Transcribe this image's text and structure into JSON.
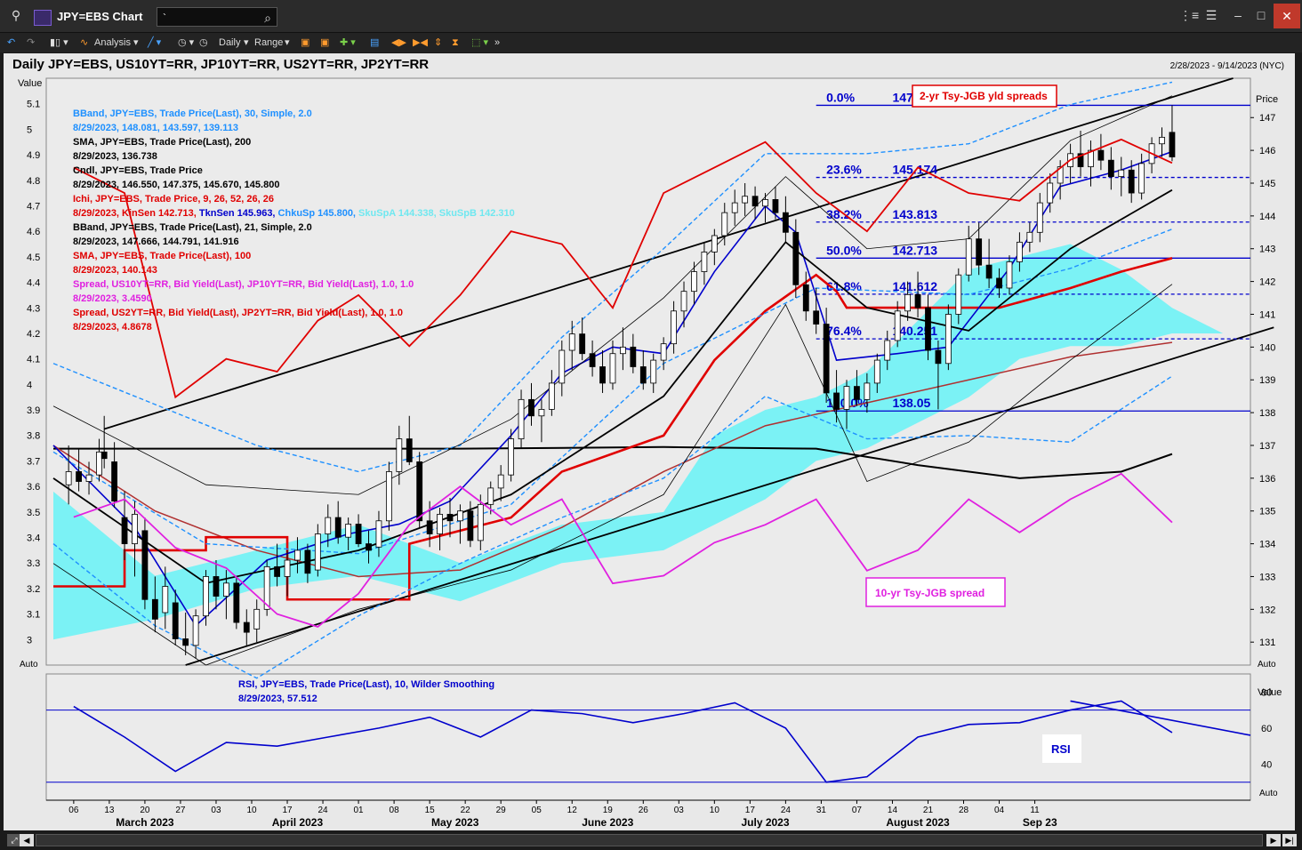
{
  "window": {
    "title": "JPY=EBS Chart (*)",
    "search_value": "`"
  },
  "toolbar": {
    "analysis_label": "Analysis",
    "interval_label": "Daily",
    "range_label": "Range"
  },
  "chart_header": {
    "title": "Daily JPY=EBS, US10YT=RR, JP10YT=RR, US2YT=RR, JP2YT=RR",
    "date_range": "2/28/2023 - 9/14/2023 (NYC)"
  },
  "axes": {
    "left_label": "Value",
    "right_label": "Price",
    "rsi_right_label": "Value",
    "auto_label": "Auto",
    "left_ticks": [
      "5.1",
      "5",
      "4.9",
      "4.8",
      "4.7",
      "4.6",
      "4.5",
      "4.4",
      "4.3",
      "4.2",
      "4.1",
      "4",
      "3.9",
      "3.8",
      "3.7",
      "3.6",
      "3.5",
      "3.4",
      "3.3",
      "3.2",
      "3.1",
      "3"
    ],
    "right_ticks": [
      "147",
      "146",
      "145",
      "144",
      "143",
      "142",
      "141",
      "140",
      "139",
      "138",
      "137",
      "136",
      "135",
      "134",
      "133",
      "132",
      "131"
    ],
    "rsi_ticks": [
      "80",
      "60",
      "40"
    ],
    "x_days": [
      "06",
      "13",
      "20",
      "27",
      "03",
      "10",
      "17",
      "24",
      "01",
      "08",
      "15",
      "22",
      "29",
      "05",
      "12",
      "19",
      "26",
      "03",
      "10",
      "17",
      "24",
      "31",
      "07",
      "14",
      "21",
      "28",
      "04",
      "11"
    ],
    "x_months": [
      "March 2023",
      "April 2023",
      "May 2023",
      "June 2023",
      "July 2023",
      "August 2023",
      "Sep 23"
    ]
  },
  "legend": [
    {
      "text": "BBand, JPY=EBS, Trade Price(Last),  30, Simple, 2.0",
      "color": "#1e90ff"
    },
    {
      "text": "8/29/2023, 148.081, 143.597, 139.113",
      "color": "#1e90ff"
    },
    {
      "text": "SMA, JPY=EBS, Trade Price(Last),  200",
      "color": "#000000"
    },
    {
      "text": "8/29/2023, 136.738",
      "color": "#000000"
    },
    {
      "text": "Cndl, JPY=EBS, Trade Price",
      "color": "#000000"
    },
    {
      "text": "8/29/2023, 146.550, 147.375, 145.670, 145.800",
      "color": "#000000"
    },
    {
      "text": "Ichi, JPY=EBS, Trade Price,  9, 26, 52, 26, 26",
      "color": "#e00000"
    },
    {
      "text": "8/29/2023, KinSen 142.713,",
      "color": "#e00000",
      "extra": [
        {
          "text": " TknSen 145.963,",
          "color": "#0000cc"
        },
        {
          "text": " ChkuSp 145.800,",
          "color": "#1e90ff"
        },
        {
          "text": " SkuSpA 144.338,",
          "color": "#6fe8f0"
        },
        {
          "text": " SkuSpB 142.310",
          "color": "#6fe8f0"
        }
      ]
    },
    {
      "text": "BBand, JPY=EBS, Trade Price(Last),  21, Simple, 2.0",
      "color": "#000000"
    },
    {
      "text": "8/29/2023, 147.666, 144.791, 141.916",
      "color": "#000000"
    },
    {
      "text": "SMA, JPY=EBS, Trade Price(Last),  100",
      "color": "#e00000"
    },
    {
      "text": "8/29/2023, 140.143",
      "color": "#e00000"
    },
    {
      "text": "Spread, US10YT=RR, Bid Yield(Last), JP10YT=RR, Bid Yield(Last),  1.0, 1.0",
      "color": "#e020e0"
    },
    {
      "text": "8/29/2023, 3.4590",
      "color": "#e020e0"
    },
    {
      "text": "Spread, US2YT=RR, Bid Yield(Last), JP2YT=RR, Bid Yield(Last),  1.0, 1.0",
      "color": "#e00000"
    },
    {
      "text": "8/29/2023, 4.8678",
      "color": "#e00000"
    }
  ],
  "fib_levels": [
    {
      "pct": "0.0%",
      "value": "147.375",
      "price": 147.375
    },
    {
      "pct": "23.6%",
      "value": "145.174",
      "price": 145.174
    },
    {
      "pct": "38.2%",
      "value": "143.813",
      "price": 143.813
    },
    {
      "pct": "50.0%",
      "value": "142.713",
      "price": 142.713
    },
    {
      "pct": "61.8%",
      "value": "141.612",
      "price": 141.612
    },
    {
      "pct": "76.4%",
      "value": "140.251",
      "price": 140.251
    },
    {
      "pct": "100.0%",
      "value": "138.05",
      "price": 138.05
    }
  ],
  "annotations": {
    "two_yr": "2-yr Tsy-JGB yld spreads",
    "ten_yr": "10-yr Tsy-JGB spread",
    "rsi_box": "RSI"
  },
  "rsi_legend": {
    "line1": "RSI, JPY=EBS, Trade Price(Last),  10, Wilder Smoothing",
    "line2": "8/29/2023, 57.512"
  },
  "chart_data": {
    "type": "line",
    "price_axis": {
      "ylim": [
        130.3,
        148.2
      ],
      "label": "Price"
    },
    "value_axis": {
      "ylim": [
        2.9,
        5.2
      ],
      "label": "Value"
    },
    "rsi_axis": {
      "ylim": [
        20,
        90
      ],
      "label": "Value"
    },
    "x_range_days": 198,
    "candles": [
      [
        3,
        135.8,
        137.0,
        135.2,
        136.2
      ],
      [
        5,
        136.2,
        136.9,
        135.6,
        135.9
      ],
      [
        7,
        135.9,
        136.5,
        135.5,
        136.1
      ],
      [
        9,
        136.1,
        137.2,
        135.9,
        136.8
      ],
      [
        10,
        136.8,
        137.9,
        136.3,
        136.6
      ],
      [
        12,
        136.5,
        137.1,
        135.1,
        135.3
      ],
      [
        14,
        134.8,
        135.6,
        133.5,
        134.0
      ],
      [
        16,
        134.0,
        135.3,
        133.0,
        134.9
      ],
      [
        18,
        134.4,
        134.8,
        132.0,
        132.3
      ],
      [
        20,
        132.3,
        133.0,
        131.3,
        131.7
      ],
      [
        22,
        131.9,
        133.3,
        131.4,
        132.7
      ],
      [
        24,
        132.2,
        132.6,
        130.9,
        131.1
      ],
      [
        26,
        131.1,
        131.9,
        130.6,
        130.9
      ],
      [
        28,
        130.9,
        132.0,
        130.5,
        131.8
      ],
      [
        30,
        131.8,
        133.2,
        131.5,
        133.0
      ],
      [
        32,
        133.0,
        133.5,
        132.0,
        132.4
      ],
      [
        34,
        132.4,
        133.2,
        131.7,
        132.8
      ],
      [
        36,
        132.8,
        133.0,
        131.4,
        131.6
      ],
      [
        38,
        131.6,
        132.0,
        130.9,
        131.3
      ],
      [
        40,
        131.4,
        132.3,
        131.0,
        132.0
      ],
      [
        42,
        132.0,
        133.5,
        131.8,
        133.3
      ],
      [
        44,
        133.3,
        134.0,
        132.7,
        133.0
      ],
      [
        46,
        133.0,
        133.8,
        132.4,
        133.5
      ],
      [
        48,
        133.5,
        134.2,
        133.1,
        133.8
      ],
      [
        50,
        133.8,
        134.0,
        132.8,
        133.1
      ],
      [
        52,
        133.2,
        134.6,
        133.0,
        134.3
      ],
      [
        54,
        134.3,
        135.2,
        133.9,
        134.8
      ],
      [
        56,
        134.8,
        135.3,
        134.0,
        134.2
      ],
      [
        58,
        134.2,
        134.8,
        133.8,
        134.6
      ],
      [
        60,
        134.6,
        134.9,
        133.9,
        134.0
      ],
      [
        62,
        134.0,
        134.4,
        133.4,
        133.8
      ],
      [
        64,
        133.9,
        135.0,
        133.6,
        134.7
      ],
      [
        66,
        134.7,
        136.5,
        134.4,
        136.2
      ],
      [
        68,
        136.2,
        137.6,
        135.8,
        137.2
      ],
      [
        70,
        137.2,
        137.9,
        136.4,
        136.5
      ],
      [
        72,
        136.5,
        136.8,
        134.5,
        134.7
      ],
      [
        74,
        134.7,
        135.3,
        133.9,
        134.3
      ],
      [
        76,
        134.3,
        135.1,
        133.8,
        134.9
      ],
      [
        78,
        134.9,
        135.4,
        134.2,
        134.7
      ],
      [
        80,
        134.7,
        135.2,
        134.0,
        135.0
      ],
      [
        82,
        135.0,
        135.3,
        133.9,
        134.1
      ],
      [
        84,
        134.1,
        135.5,
        133.8,
        135.2
      ],
      [
        86,
        135.2,
        135.9,
        134.9,
        135.7
      ],
      [
        88,
        135.7,
        136.4,
        135.3,
        136.1
      ],
      [
        90,
        136.1,
        137.5,
        135.9,
        137.2
      ],
      [
        92,
        137.2,
        138.7,
        136.9,
        138.4
      ],
      [
        94,
        138.4,
        138.9,
        137.6,
        137.9
      ],
      [
        96,
        137.9,
        138.4,
        137.1,
        138.1
      ],
      [
        98,
        138.1,
        139.3,
        137.9,
        138.9
      ],
      [
        100,
        138.9,
        140.2,
        138.5,
        139.9
      ],
      [
        102,
        139.9,
        140.8,
        139.3,
        140.4
      ],
      [
        104,
        140.4,
        140.9,
        139.6,
        139.8
      ],
      [
        106,
        139.8,
        140.2,
        139.1,
        139.4
      ],
      [
        108,
        139.4,
        139.9,
        138.6,
        138.9
      ],
      [
        110,
        138.9,
        140.2,
        138.7,
        139.8
      ],
      [
        112,
        139.8,
        140.6,
        139.3,
        140.0
      ],
      [
        114,
        140.0,
        140.4,
        139.2,
        139.4
      ],
      [
        116,
        139.4,
        139.9,
        138.7,
        138.9
      ],
      [
        118,
        138.9,
        139.8,
        138.6,
        139.6
      ],
      [
        120,
        139.6,
        140.3,
        139.3,
        140.1
      ],
      [
        122,
        140.1,
        141.4,
        139.8,
        141.1
      ],
      [
        124,
        141.1,
        142.0,
        140.6,
        141.7
      ],
      [
        126,
        141.7,
        142.6,
        141.3,
        142.3
      ],
      [
        128,
        142.3,
        143.2,
        141.9,
        142.9
      ],
      [
        130,
        142.9,
        143.6,
        142.5,
        143.4
      ],
      [
        132,
        143.4,
        144.4,
        143.1,
        144.1
      ],
      [
        134,
        144.1,
        144.8,
        143.7,
        144.4
      ],
      [
        136,
        144.4,
        145.0,
        144.0,
        144.6
      ],
      [
        138,
        144.6,
        144.9,
        143.9,
        144.3
      ],
      [
        140,
        144.3,
        144.7,
        143.8,
        144.5
      ],
      [
        142,
        144.5,
        144.9,
        143.9,
        144.1
      ],
      [
        144,
        144.1,
        144.6,
        143.2,
        143.5
      ],
      [
        146,
        143.5,
        143.9,
        141.5,
        141.9
      ],
      [
        148,
        141.9,
        142.3,
        140.8,
        141.1
      ],
      [
        150,
        141.1,
        141.8,
        140.4,
        140.7
      ],
      [
        152,
        140.7,
        141.2,
        138.3,
        138.6
      ],
      [
        154,
        138.6,
        139.3,
        137.7,
        138.1
      ],
      [
        156,
        138.1,
        139.0,
        137.5,
        138.8
      ],
      [
        158,
        138.8,
        139.3,
        138.2,
        138.4
      ],
      [
        160,
        138.4,
        139.2,
        138.0,
        138.9
      ],
      [
        162,
        138.9,
        139.8,
        138.6,
        139.6
      ],
      [
        164,
        139.6,
        140.5,
        139.3,
        140.2
      ],
      [
        166,
        140.2,
        141.4,
        140.0,
        141.1
      ],
      [
        168,
        141.1,
        142.0,
        140.8,
        141.6
      ],
      [
        170,
        141.6,
        142.3,
        140.9,
        141.2
      ],
      [
        172,
        141.2,
        141.6,
        139.6,
        139.9
      ],
      [
        174,
        139.9,
        140.2,
        138.1,
        139.5
      ],
      [
        176,
        139.5,
        141.3,
        139.3,
        141.0
      ],
      [
        178,
        141.0,
        142.4,
        140.7,
        142.2
      ],
      [
        180,
        142.2,
        143.7,
        142.0,
        143.3
      ],
      [
        182,
        143.3,
        143.8,
        142.2,
        142.5
      ],
      [
        184,
        142.5,
        143.3,
        141.8,
        142.1
      ],
      [
        186,
        142.1,
        142.4,
        141.5,
        141.8
      ],
      [
        188,
        141.8,
        142.8,
        141.6,
        142.6
      ],
      [
        190,
        142.6,
        143.5,
        142.3,
        143.2
      ],
      [
        192,
        143.2,
        143.8,
        142.9,
        143.5
      ],
      [
        194,
        143.5,
        144.7,
        143.2,
        144.4
      ],
      [
        196,
        144.4,
        145.3,
        144.1,
        145.0
      ],
      [
        198,
        145.0,
        145.7,
        144.5,
        145.5
      ],
      [
        200,
        145.5,
        146.2,
        145.0,
        145.9
      ],
      [
        202,
        145.9,
        146.6,
        145.2,
        145.5
      ],
      [
        204,
        145.5,
        146.3,
        144.9,
        146.0
      ],
      [
        206,
        146.0,
        146.5,
        145.4,
        145.7
      ],
      [
        208,
        145.7,
        146.1,
        144.8,
        145.2
      ],
      [
        210,
        145.2,
        145.8,
        144.6,
        145.4
      ],
      [
        212,
        145.4,
        145.7,
        144.4,
        144.7
      ],
      [
        214,
        144.7,
        145.9,
        144.5,
        145.6
      ],
      [
        216,
        145.6,
        146.4,
        145.3,
        146.2
      ],
      [
        218,
        146.2,
        146.7,
        145.8,
        146.4
      ],
      [
        220,
        146.55,
        147.375,
        145.67,
        145.8
      ]
    ],
    "bbands": [
      {
        "name": "BBand 30",
        "last": [
          148.081,
          143.597,
          139.113
        ],
        "color": "#1e90ff"
      },
      {
        "name": "BBand 21",
        "last": [
          147.666,
          144.791,
          141.916
        ],
        "color": "#000000"
      }
    ],
    "sma200_last": 136.738,
    "sma100_last": 140.143,
    "ichimoku_last": {
      "KinSen": 142.713,
      "TknSen": 145.963,
      "ChkuSp": 145.8,
      "SkuSpA": 144.338,
      "SkuSpB": 142.31
    },
    "spread_10y": [
      [
        4,
        3.48
      ],
      [
        14,
        3.55
      ],
      [
        24,
        3.36
      ],
      [
        34,
        3.28
      ],
      [
        44,
        3.1
      ],
      [
        52,
        3.05
      ],
      [
        60,
        3.18
      ],
      [
        70,
        3.45
      ],
      [
        80,
        3.6
      ],
      [
        90,
        3.45
      ],
      [
        100,
        3.55
      ],
      [
        110,
        3.22
      ],
      [
        120,
        3.25
      ],
      [
        130,
        3.38
      ],
      [
        140,
        3.45
      ],
      [
        150,
        3.55
      ],
      [
        160,
        3.27
      ],
      [
        170,
        3.35
      ],
      [
        180,
        3.55
      ],
      [
        190,
        3.42
      ],
      [
        200,
        3.55
      ],
      [
        210,
        3.65
      ],
      [
        220,
        3.459
      ]
    ],
    "spread_2y": [
      [
        4,
        4.85
      ],
      [
        14,
        4.75
      ],
      [
        24,
        3.95
      ],
      [
        34,
        4.1
      ],
      [
        44,
        4.05
      ],
      [
        52,
        4.25
      ],
      [
        60,
        4.35
      ],
      [
        70,
        4.15
      ],
      [
        80,
        4.35
      ],
      [
        90,
        4.6
      ],
      [
        100,
        4.55
      ],
      [
        110,
        4.3
      ],
      [
        120,
        4.75
      ],
      [
        130,
        4.85
      ],
      [
        140,
        4.95
      ],
      [
        150,
        4.75
      ],
      [
        160,
        4.6
      ],
      [
        170,
        4.85
      ],
      [
        180,
        4.75
      ],
      [
        190,
        4.72
      ],
      [
        200,
        4.88
      ],
      [
        210,
        4.96
      ],
      [
        220,
        4.8678
      ]
    ],
    "rsi": [
      [
        4,
        72
      ],
      [
        14,
        55
      ],
      [
        24,
        36
      ],
      [
        34,
        52
      ],
      [
        44,
        50
      ],
      [
        54,
        55
      ],
      [
        64,
        60
      ],
      [
        74,
        66
      ],
      [
        84,
        55
      ],
      [
        94,
        70
      ],
      [
        104,
        68
      ],
      [
        114,
        63
      ],
      [
        124,
        68
      ],
      [
        134,
        74
      ],
      [
        144,
        60
      ],
      [
        152,
        30
      ],
      [
        160,
        33
      ],
      [
        170,
        55
      ],
      [
        180,
        62
      ],
      [
        190,
        63
      ],
      [
        200,
        70
      ],
      [
        210,
        75
      ],
      [
        220,
        57.512
      ]
    ]
  }
}
